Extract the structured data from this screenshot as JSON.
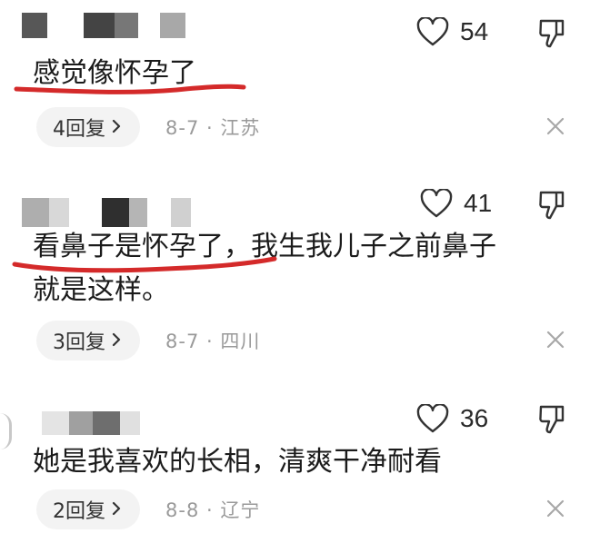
{
  "comments": [
    {
      "likes": "54",
      "text_lines": [
        "感觉像怀孕了"
      ],
      "replies": "4回复",
      "date": "8-7",
      "location": "江苏"
    },
    {
      "likes": "41",
      "text_lines": [
        "看鼻子是怀孕了，我生我儿子之前鼻子",
        "就是这样。"
      ],
      "replies": "3回复",
      "date": "8-7",
      "location": "四川"
    },
    {
      "likes": "36",
      "text_lines": [
        "她是我喜欢的长相，清爽干净耐看"
      ],
      "replies": "2回复",
      "date": "8-8",
      "location": "辽宁"
    }
  ],
  "icons": {
    "like": "heart-outline-icon",
    "dislike": "thumbs-down-outline-icon",
    "reply_more": "chevron-right-icon",
    "close": "close-x-icon"
  },
  "colors": {
    "underline": "#d42a2a",
    "meta_text": "#9a9a9a",
    "pill_bg": "#f3f3f3"
  }
}
